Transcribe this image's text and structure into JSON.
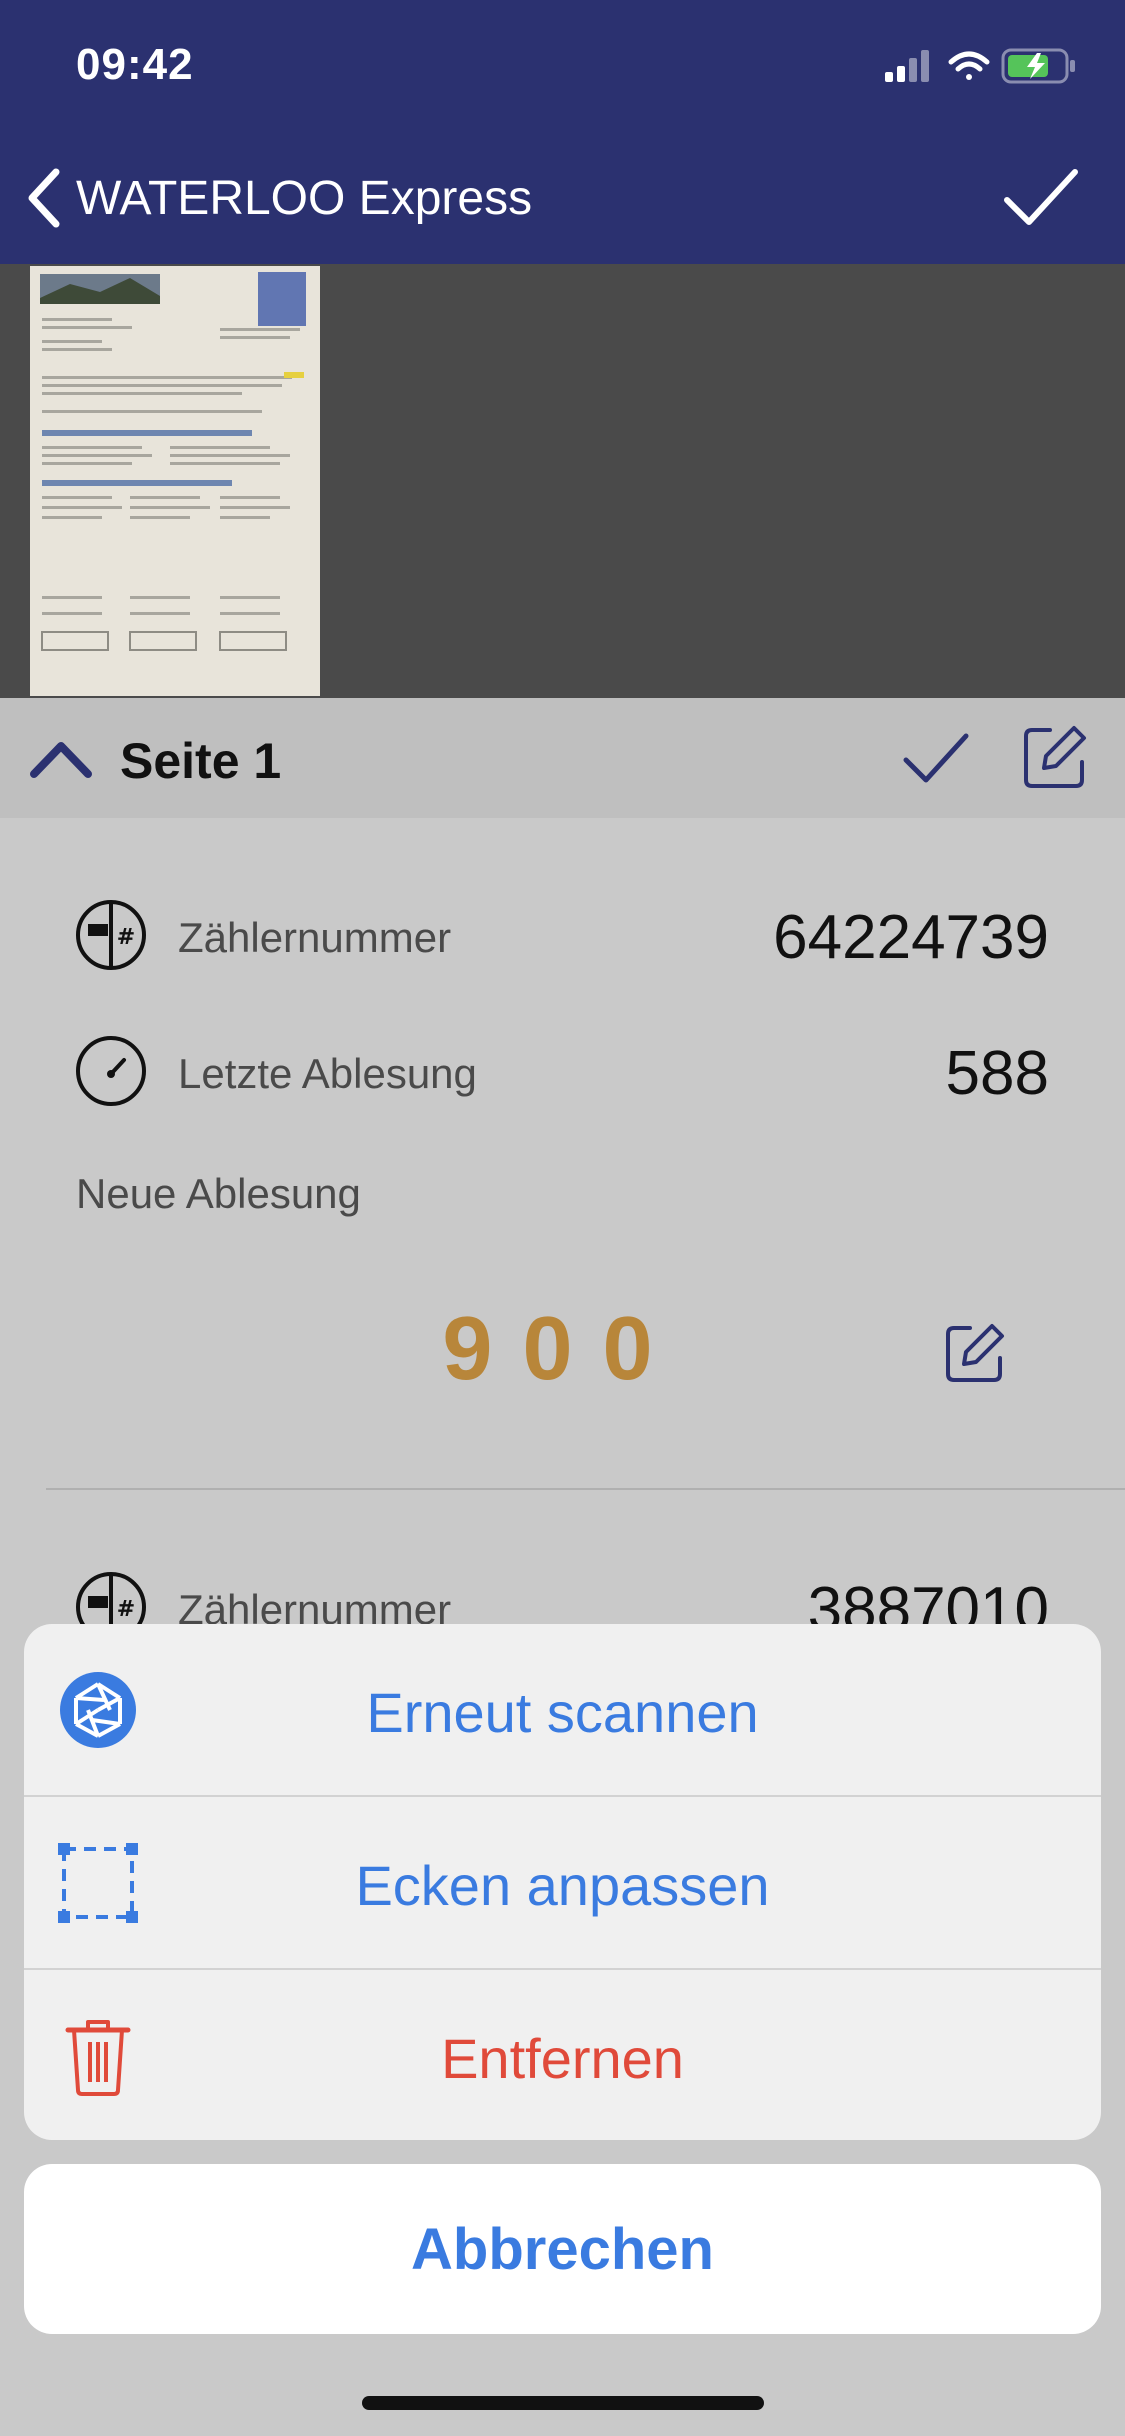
{
  "status_bar": {
    "time": "09:42"
  },
  "nav": {
    "back_label": "WATERLOO Express"
  },
  "page": {
    "title": "Seite 1"
  },
  "meter1": {
    "number_label": "Zählernummer",
    "number_value": "64224739",
    "last_label": "Letzte Ablesung",
    "last_value": "588",
    "new_label": "Neue Ablesung",
    "new_value": "900"
  },
  "meter2": {
    "number_label": "Zählernummer",
    "number_value": "3887010"
  },
  "action_sheet": {
    "rescan": "Erneut scannen",
    "adjust_corners": "Ecken anpassen",
    "remove": "Entfernen",
    "cancel": "Abbrechen"
  },
  "colors": {
    "nav_bg": "#2b3170",
    "accent_blue": "#3a7be0",
    "destructive_red": "#e04a3a",
    "reading_gold": "#b8863a"
  },
  "icons": [
    "chevron-left-icon",
    "checkmark-icon",
    "chevron-up-icon",
    "edit-icon",
    "meter-number-icon",
    "gauge-icon",
    "camera-shutter-icon",
    "crop-corners-icon",
    "trash-icon"
  ]
}
